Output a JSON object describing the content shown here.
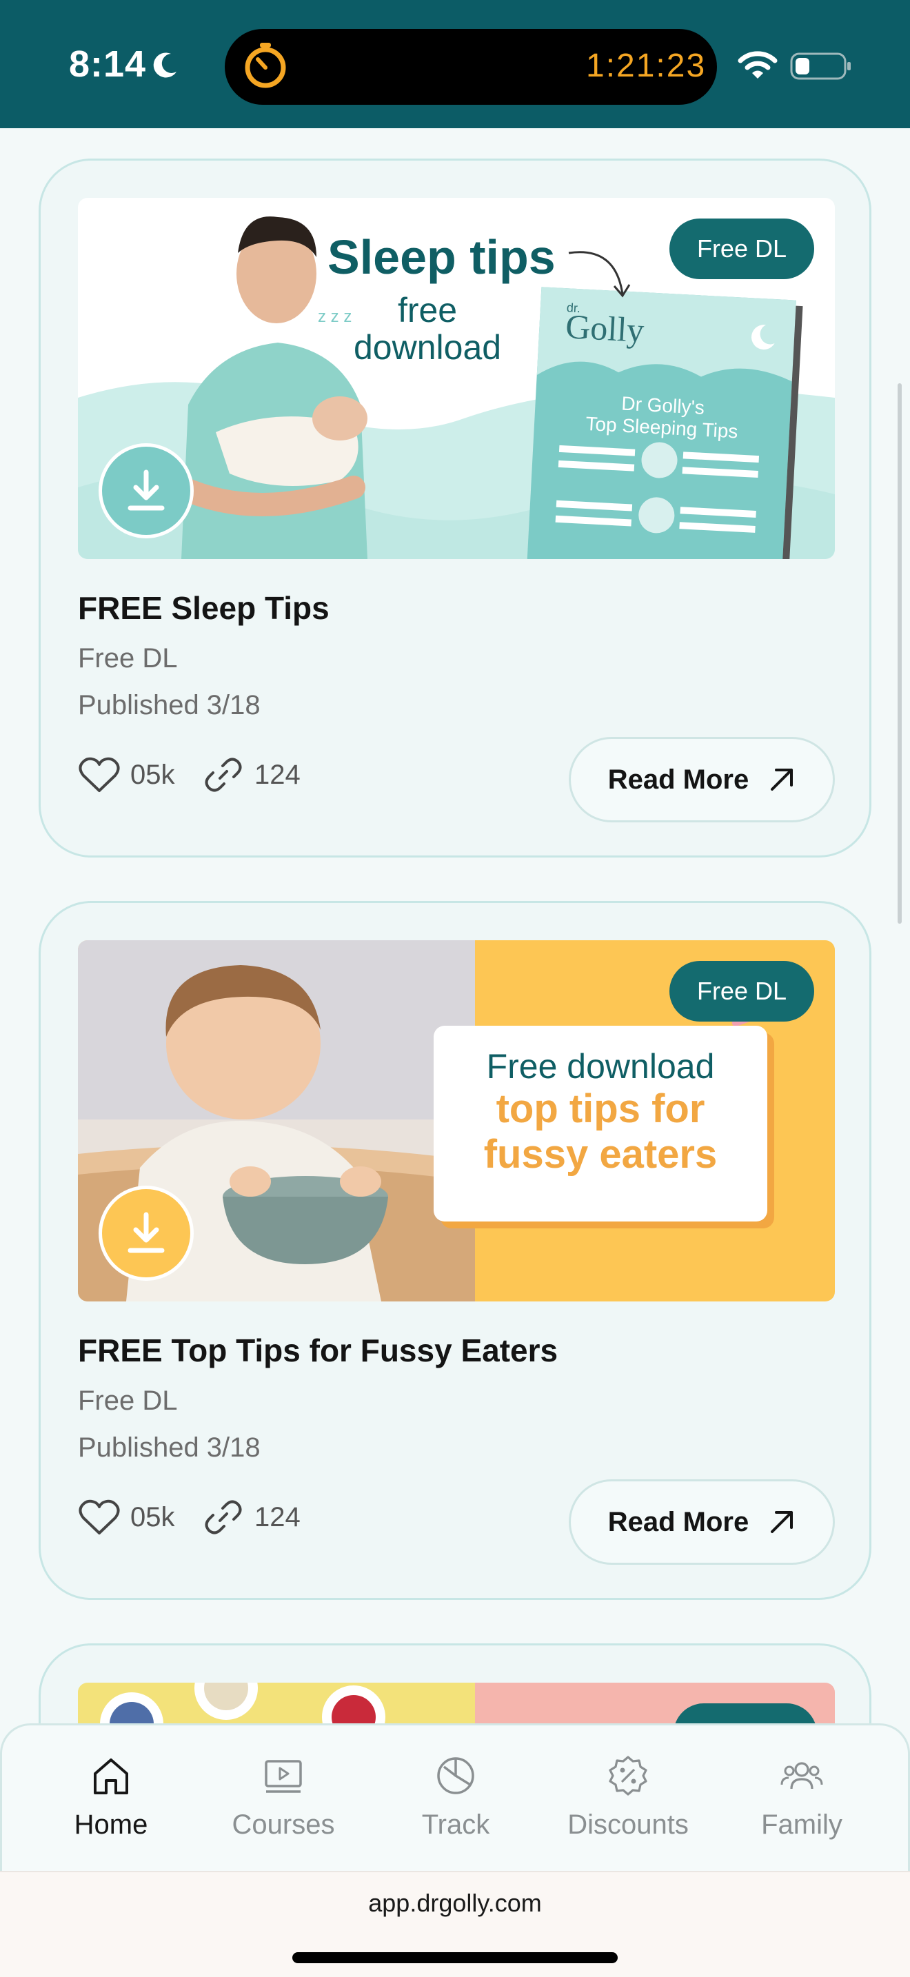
{
  "status": {
    "time": "8:14",
    "timer": "1:21:23"
  },
  "cards": [
    {
      "badge": "Free DL",
      "banner_title": "Sleep tips",
      "banner_sub_1": "free",
      "banner_sub_2": "download",
      "booklet_brand": "Golly",
      "booklet_brand_small": "dr.",
      "booklet_title_1": "Dr Golly's",
      "booklet_title_2": "Top Sleeping Tips",
      "title": "FREE Sleep Tips",
      "category": "Free DL",
      "published": "Published 3/18",
      "likes": "05k",
      "links": "124",
      "read_more": "Read More",
      "accent": "#7ccbc6"
    },
    {
      "badge": "Free DL",
      "banner_line1": "Free download",
      "banner_line2": "top tips for",
      "banner_line3": "fussy eaters",
      "title": "FREE Top Tips for Fussy Eaters",
      "category": "Free DL",
      "published": "Published 3/18",
      "likes": "05k",
      "links": "124",
      "read_more": "Read More",
      "accent": "#fdc654"
    }
  ],
  "nav": [
    {
      "label": "Home",
      "icon": "home-icon",
      "active": true
    },
    {
      "label": "Courses",
      "icon": "play-icon",
      "active": false
    },
    {
      "label": "Track",
      "icon": "pie-chart-icon",
      "active": false
    },
    {
      "label": "Discounts",
      "icon": "discount-badge-icon",
      "active": false
    },
    {
      "label": "Family",
      "icon": "family-icon",
      "active": false
    }
  ],
  "url": "app.drgolly.com",
  "colors": {
    "teal": "#0c5c66",
    "badge": "#146b6f",
    "yellow": "#fdc654",
    "mint": "#7ccbc6"
  }
}
